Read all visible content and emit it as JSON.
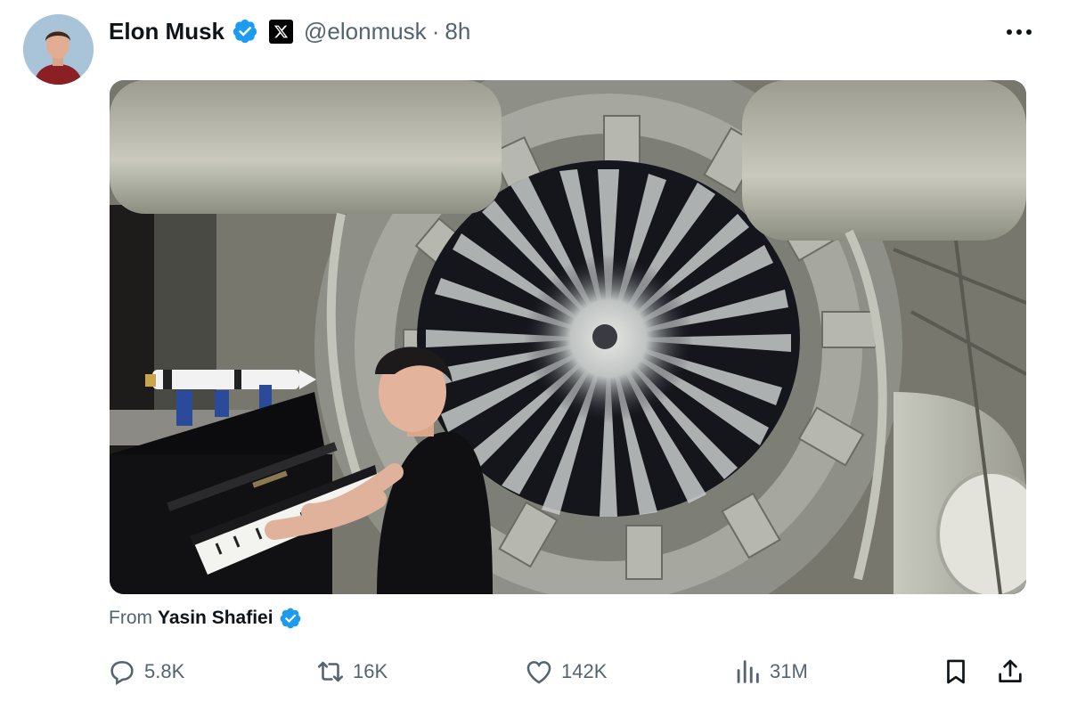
{
  "author": {
    "display_name": "Elon Musk",
    "handle": "@elonmusk",
    "separator": "·",
    "time": "8h",
    "verified_color": "#1d9bf0"
  },
  "icons": {
    "verified": "verified-badge-icon",
    "affiliate": "x-logo-icon",
    "more": "more-options-icon"
  },
  "media": {
    "type": "video",
    "description_icon": "video-frame"
  },
  "attribution": {
    "from_label": "From",
    "from_name": "Yasin Shafiei"
  },
  "actions": {
    "replies": {
      "icon": "reply-icon",
      "count": "5.8K"
    },
    "reposts": {
      "icon": "repost-icon",
      "count": "16K"
    },
    "likes": {
      "icon": "like-icon",
      "count": "142K"
    },
    "views": {
      "icon": "views-icon",
      "count": "31M"
    },
    "bookmark": {
      "icon": "bookmark-icon"
    },
    "share": {
      "icon": "share-icon"
    }
  },
  "colors": {
    "text_primary": "#0f1419",
    "text_secondary": "#536471",
    "accent": "#1d9bf0"
  }
}
